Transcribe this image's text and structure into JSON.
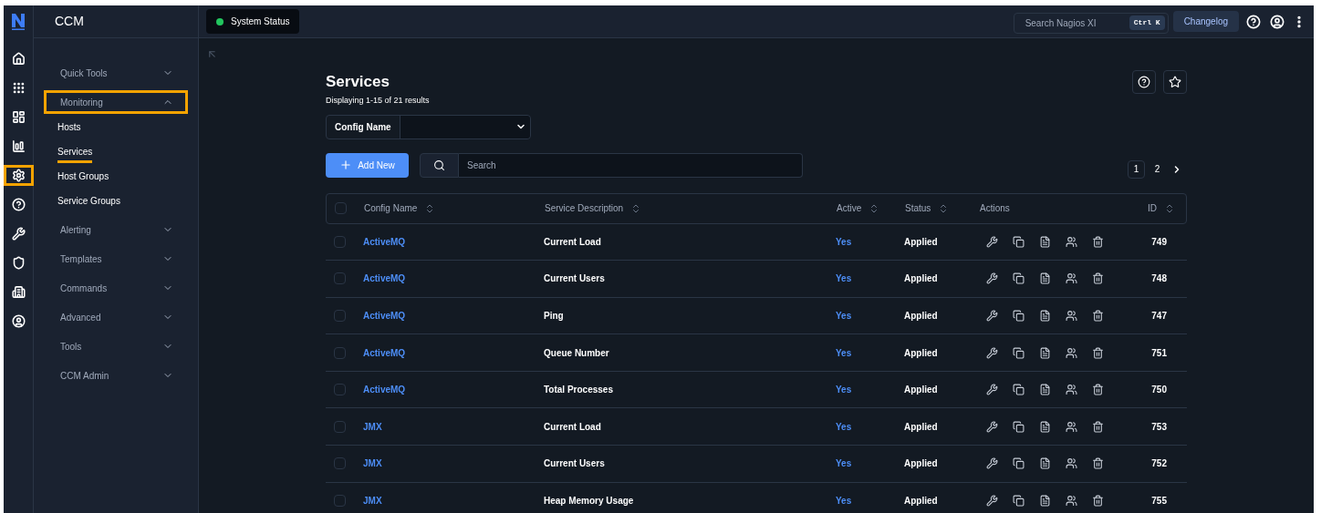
{
  "app": {
    "title": "CCM"
  },
  "rail": [
    {
      "kind": "home",
      "highlighted": false
    },
    {
      "kind": "grid",
      "highlighted": false
    },
    {
      "kind": "dashboard",
      "highlighted": false
    },
    {
      "kind": "chart",
      "highlighted": false
    },
    {
      "kind": "gear",
      "highlighted": true
    },
    {
      "kind": "help",
      "highlighted": false
    },
    {
      "kind": "wrench",
      "highlighted": false
    },
    {
      "kind": "shield",
      "highlighted": false
    },
    {
      "kind": "building",
      "highlighted": false
    },
    {
      "kind": "user",
      "highlighted": false
    }
  ],
  "header": {
    "status_button": "System Status",
    "search": {
      "placeholder": "Search Nagios XI",
      "shortcut": "Ctrl K"
    },
    "changelog": "Changelog"
  },
  "sidebar": {
    "groups": [
      {
        "label": "Quick Tools",
        "expanded": false,
        "highlighted": false
      },
      {
        "label": "Monitoring",
        "expanded": true,
        "highlighted": true,
        "children": [
          {
            "label": "Hosts",
            "selected": false
          },
          {
            "label": "Services",
            "selected": true
          },
          {
            "label": "Host Groups",
            "selected": false
          },
          {
            "label": "Service Groups",
            "selected": false
          }
        ]
      },
      {
        "label": "Alerting",
        "expanded": false,
        "highlighted": false
      },
      {
        "label": "Templates",
        "expanded": false,
        "highlighted": false
      },
      {
        "label": "Commands",
        "expanded": false,
        "highlighted": false
      },
      {
        "label": "Advanced",
        "expanded": false,
        "highlighted": false
      },
      {
        "label": "Tools",
        "expanded": false,
        "highlighted": false
      },
      {
        "label": "CCM Admin",
        "expanded": false,
        "highlighted": false
      }
    ]
  },
  "page": {
    "title": "Services",
    "subtitle": "Displaying 1-15 of 21 results",
    "filter_label": "Config Name",
    "add_button": "Add New",
    "search": {
      "placeholder": "Search"
    },
    "pagination": [
      {
        "label": "1",
        "selected": true
      },
      {
        "label": "2",
        "selected": false
      }
    ]
  },
  "table": {
    "select_all": {
      "checked": false
    },
    "columns": [
      {
        "label": "Config Name",
        "sortable": true
      },
      {
        "label": "Service Description",
        "sortable": true
      },
      {
        "label": "Active",
        "sortable": true
      },
      {
        "label": "Status",
        "sortable": true
      },
      {
        "label": "Actions",
        "sortable": false
      },
      {
        "label": "ID",
        "sortable": true
      }
    ],
    "rows": [
      {
        "checked": false,
        "config": "ActiveMQ",
        "description": "Current Load",
        "active": "Yes",
        "status": "Applied",
        "id": "749"
      },
      {
        "checked": false,
        "config": "ActiveMQ",
        "description": "Current Users",
        "active": "Yes",
        "status": "Applied",
        "id": "748"
      },
      {
        "checked": false,
        "config": "ActiveMQ",
        "description": "Ping",
        "active": "Yes",
        "status": "Applied",
        "id": "747"
      },
      {
        "checked": false,
        "config": "ActiveMQ",
        "description": "Queue Number",
        "active": "Yes",
        "status": "Applied",
        "id": "751"
      },
      {
        "checked": false,
        "config": "ActiveMQ",
        "description": "Total Processes",
        "active": "Yes",
        "status": "Applied",
        "id": "750"
      },
      {
        "checked": false,
        "config": "JMX",
        "description": "Current Load",
        "active": "Yes",
        "status": "Applied",
        "id": "753"
      },
      {
        "checked": false,
        "config": "JMX",
        "description": "Current Users",
        "active": "Yes",
        "status": "Applied",
        "id": "752"
      },
      {
        "checked": false,
        "config": "JMX",
        "description": "Heap Memory Usage",
        "active": "Yes",
        "status": "Applied",
        "id": "755"
      }
    ]
  }
}
